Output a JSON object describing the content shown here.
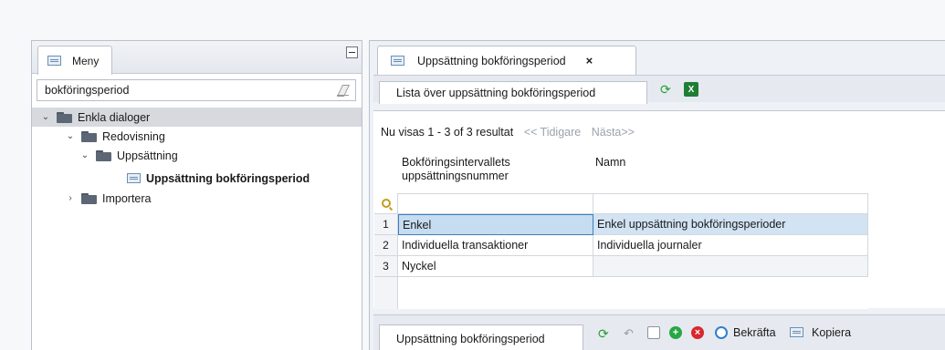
{
  "menu": {
    "tab_label": "Meny",
    "search_value": "bokföringsperiod",
    "tree": [
      {
        "label": "Enkla dialoger",
        "expanded": true
      },
      {
        "label": "Redovisning",
        "expanded": true
      },
      {
        "label": "Uppsättning",
        "expanded": true
      },
      {
        "label": "Uppsättning bokföringsperiod"
      },
      {
        "label": "Importera",
        "expanded": false
      }
    ]
  },
  "main_tab": {
    "label": "Uppsättning bokföringsperiod",
    "close": "×"
  },
  "sub_tab": {
    "label": "Lista över uppsättning bokföringsperiod"
  },
  "results": {
    "summary": "Nu visas 1 - 3 of 3 resultat",
    "prev": "<< Tidigare",
    "next": "Nästa>>"
  },
  "table": {
    "columns": [
      "Bokföringsintervallets uppsättningsnummer",
      "Namn"
    ],
    "rows": [
      {
        "num": "1",
        "col1": "Enkel",
        "col2": "Enkel uppsättning bokföringsperioder"
      },
      {
        "num": "2",
        "col1": "Individuella transaktioner",
        "col2": "Individuella journaler"
      },
      {
        "num": "3",
        "col1": "Nyckel",
        "col2": ""
      }
    ]
  },
  "bottom": {
    "tab_label": "Uppsättning bokföringsperiod",
    "confirm_label": "Bekräfta",
    "copy_label": "Kopiera"
  }
}
